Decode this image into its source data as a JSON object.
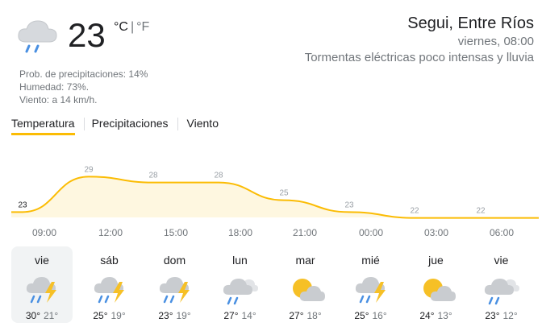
{
  "current": {
    "temp": "23",
    "unit_c": "°C",
    "unit_sep": "|",
    "unit_f": "°F",
    "icon": "rain-cloud-icon",
    "precip": "Prob. de precipitaciones: 14%",
    "humidity": "Humedad: 73%.",
    "wind": "Viento: a 14 km/h."
  },
  "location": {
    "city": "Segui, Entre Ríos",
    "time": "viernes, 08:00",
    "condition": "Tormentas eléctricas poco intensas y lluvia"
  },
  "tabs": [
    "Temperatura",
    "Precipitaciones",
    "Viento"
  ],
  "colors": {
    "accent": "#fbbc04",
    "fill": "#fef7e0",
    "line": "#fbbc04"
  },
  "chart_data": {
    "type": "area",
    "x": [
      "09:00",
      "12:00",
      "15:00",
      "18:00",
      "21:00",
      "00:00",
      "03:00",
      "06:00"
    ],
    "values": [
      23,
      29,
      28,
      28,
      25,
      23,
      22,
      22
    ],
    "labels": [
      "23",
      "29",
      "28",
      "28",
      "25",
      "23",
      "22",
      "22"
    ],
    "grid": false
  },
  "hours": [
    "09:00",
    "12:00",
    "15:00",
    "18:00",
    "21:00",
    "00:00",
    "03:00",
    "06:00"
  ],
  "days": [
    {
      "name": "vie",
      "hi": "30°",
      "lo": "21°",
      "icon": "thunderstorm-rain-icon"
    },
    {
      "name": "sáb",
      "hi": "25°",
      "lo": "19°",
      "icon": "thunderstorm-rain-icon"
    },
    {
      "name": "dom",
      "hi": "23°",
      "lo": "19°",
      "icon": "thunderstorm-rain-icon"
    },
    {
      "name": "lun",
      "hi": "27°",
      "lo": "14°",
      "icon": "rain-cloud-icon"
    },
    {
      "name": "mar",
      "hi": "27°",
      "lo": "18°",
      "icon": "partly-cloudy-icon"
    },
    {
      "name": "mié",
      "hi": "25°",
      "lo": "16°",
      "icon": "thunderstorm-rain-icon"
    },
    {
      "name": "jue",
      "hi": "24°",
      "lo": "13°",
      "icon": "partly-cloudy-icon"
    },
    {
      "name": "vie",
      "hi": "23°",
      "lo": "12°",
      "icon": "rain-cloud-icon"
    }
  ]
}
